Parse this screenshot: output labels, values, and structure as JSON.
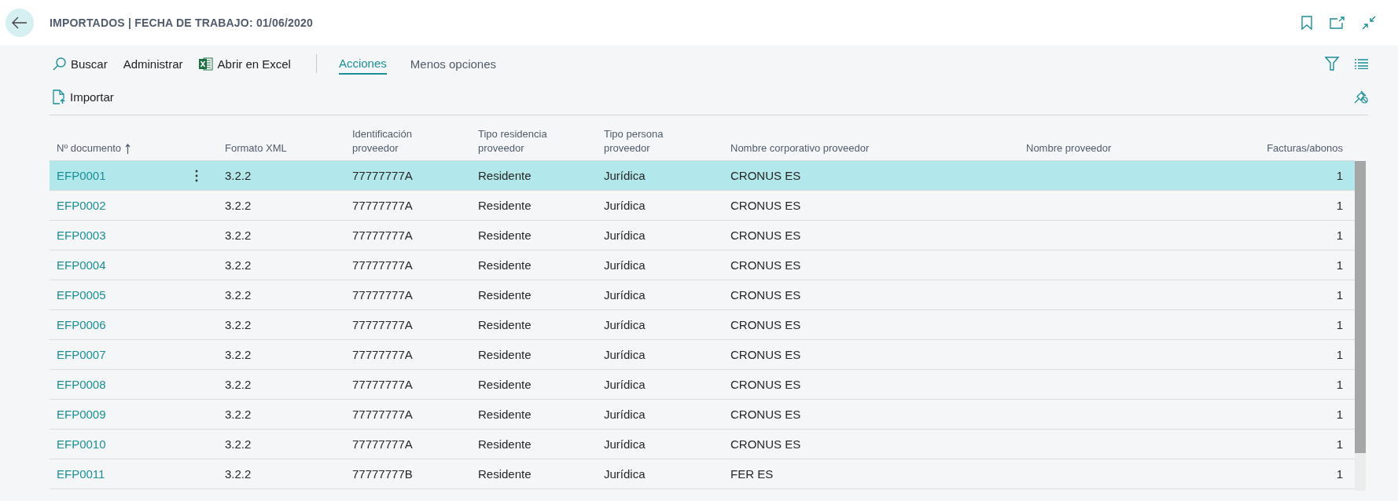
{
  "header": {
    "title": "IMPORTADOS | FECHA DE TRABAJO: 01/06/2020"
  },
  "toolbar": {
    "actions": [
      {
        "label": "Buscar",
        "kind": "search"
      },
      {
        "label": "Administrar",
        "kind": "plain"
      },
      {
        "label": "Abrir en Excel",
        "kind": "excel"
      }
    ],
    "tabs": [
      {
        "label": "Acciones",
        "selected": true
      }
    ],
    "more_button": "Menos opciones",
    "subactions": [
      {
        "label": "Importar",
        "kind": "import"
      }
    ]
  },
  "table": {
    "columns": [
      {
        "label": "Nº documento",
        "kind": "link",
        "sorted": true
      },
      {
        "label": "Formato XML",
        "kind": "text",
        "sorted": false
      },
      {
        "label": "Identificación proveedor",
        "kind": "text",
        "sorted": false
      },
      {
        "label": "Tipo residencia proveedor",
        "kind": "text",
        "sorted": false
      },
      {
        "label": "Tipo persona proveedor",
        "kind": "text",
        "sorted": false
      },
      {
        "label": "Nombre corporativo proveedor",
        "kind": "text",
        "sorted": false
      },
      {
        "label": "Nombre proveedor",
        "kind": "text",
        "sorted": false
      },
      {
        "label": "Facturas/abonos",
        "kind": "number",
        "sorted": false
      }
    ],
    "rows": [
      {
        "selected": true,
        "cells": [
          "EFP0001",
          "3.2.2",
          "77777777A",
          "Residente",
          "Jurídica",
          "CRONUS ES",
          "",
          "1"
        ]
      },
      {
        "selected": false,
        "cells": [
          "EFP0002",
          "3.2.2",
          "77777777A",
          "Residente",
          "Jurídica",
          "CRONUS ES",
          "",
          "1"
        ]
      },
      {
        "selected": false,
        "cells": [
          "EFP0003",
          "3.2.2",
          "77777777A",
          "Residente",
          "Jurídica",
          "CRONUS ES",
          "",
          "1"
        ]
      },
      {
        "selected": false,
        "cells": [
          "EFP0004",
          "3.2.2",
          "77777777A",
          "Residente",
          "Jurídica",
          "CRONUS ES",
          "",
          "1"
        ]
      },
      {
        "selected": false,
        "cells": [
          "EFP0005",
          "3.2.2",
          "77777777A",
          "Residente",
          "Jurídica",
          "CRONUS ES",
          "",
          "1"
        ]
      },
      {
        "selected": false,
        "cells": [
          "EFP0006",
          "3.2.2",
          "77777777A",
          "Residente",
          "Jurídica",
          "CRONUS ES",
          "",
          "1"
        ]
      },
      {
        "selected": false,
        "cells": [
          "EFP0007",
          "3.2.2",
          "77777777A",
          "Residente",
          "Jurídica",
          "CRONUS ES",
          "",
          "1"
        ]
      },
      {
        "selected": false,
        "cells": [
          "EFP0008",
          "3.2.2",
          "77777777A",
          "Residente",
          "Jurídica",
          "CRONUS ES",
          "",
          "1"
        ]
      },
      {
        "selected": false,
        "cells": [
          "EFP0009",
          "3.2.2",
          "77777777A",
          "Residente",
          "Jurídica",
          "CRONUS ES",
          "",
          "1"
        ]
      },
      {
        "selected": false,
        "cells": [
          "EFP0010",
          "3.2.2",
          "77777777A",
          "Residente",
          "Jurídica",
          "CRONUS ES",
          "",
          "1"
        ]
      },
      {
        "selected": false,
        "cells": [
          "EFP0011",
          "3.2.2",
          "77777777B",
          "Residente",
          "Jurídica",
          "FER ES",
          "",
          "1"
        ]
      }
    ]
  }
}
